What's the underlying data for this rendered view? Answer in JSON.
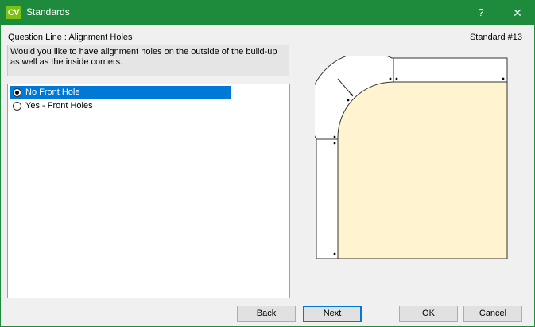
{
  "window": {
    "app_icon_text": "CV",
    "title": "Standards",
    "help_glyph": "?",
    "close_glyph": "✕"
  },
  "question_line": "Question Line : Alignment Holes",
  "standard_label": "Standard #13",
  "prompt": "Would you like to have alignment holes on the outside of the build-up as well as the inside corners.",
  "options": [
    {
      "label": "No Front Hole",
      "selected": true
    },
    {
      "label": "Yes - Front Holes",
      "selected": false
    }
  ],
  "buttons": {
    "back": "Back",
    "next": "Next",
    "ok": "OK",
    "cancel": "Cancel"
  },
  "colors": {
    "titlebar": "#1e8a3c",
    "selection": "#0078d7",
    "panel_fill": "#fff3d0"
  }
}
